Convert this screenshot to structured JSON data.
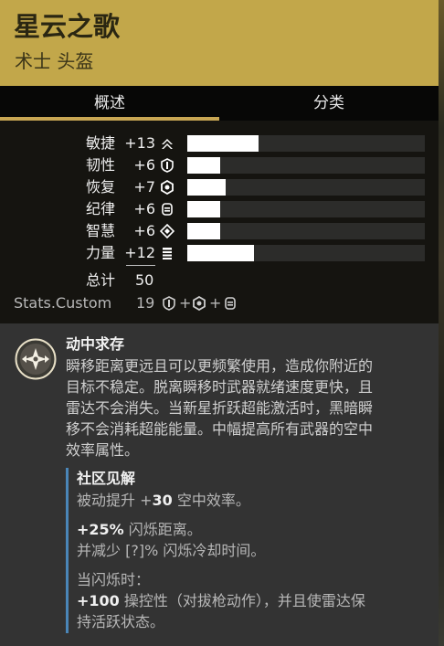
{
  "header": {
    "title": "星云之歌",
    "subtitle": "术士 头盔",
    "bg_color": "#c2a74a"
  },
  "tabs": [
    {
      "label": "概述",
      "selected": true
    },
    {
      "label": "分类",
      "selected": false
    }
  ],
  "stats": [
    {
      "name": "敏捷",
      "value": "+13",
      "icon": "mobility-icon",
      "fill": 0.3
    },
    {
      "name": "韧性",
      "value": "+6",
      "icon": "resilience-icon",
      "fill": 0.14
    },
    {
      "name": "恢复",
      "value": "+7",
      "icon": "recovery-icon",
      "fill": 0.16
    },
    {
      "name": "纪律",
      "value": "+6",
      "icon": "discipline-icon",
      "fill": 0.14
    },
    {
      "name": "智慧",
      "value": "+6",
      "icon": "intellect-icon",
      "fill": 0.14
    },
    {
      "name": "力量",
      "value": "+12",
      "icon": "strength-icon",
      "fill": 0.28
    }
  ],
  "total": {
    "label": "总计",
    "value": "50"
  },
  "custom": {
    "label": "Stats.Custom",
    "value": "19",
    "icons": [
      "resilience-icon",
      "recovery-icon",
      "discipline-icon"
    ],
    "plus": "+"
  },
  "perk": {
    "name": "动中求存",
    "icon": "perk-icon",
    "desc_lines": [
      "瞬移距离更远且可以更频繁使用，造成你附近的",
      "目标不稳定。脱离瞬移时武器就绪速度更快，且",
      "雷达不会消失。当新星折跃超能激活时，黑暗瞬",
      "移不会消耗超能能量。中幅提高所有武器的空中",
      "效率属性。"
    ]
  },
  "insight": {
    "title": "社区见解",
    "line1_pre": "被动提升 +",
    "line1_bold": "30",
    "line1_post": " 空中效率。",
    "line2_bold": "+25%",
    "line2_post": " 闪烁距离。",
    "line3": "并减少 [?]% 闪烁冷却时间。",
    "line4": "当闪烁时：",
    "line5_bold": "+100",
    "line5_post": " 操控性（对拔枪动作），并且使雷达保",
    "line6": "持活跃状态。",
    "accent_color": "#4a86b8"
  }
}
